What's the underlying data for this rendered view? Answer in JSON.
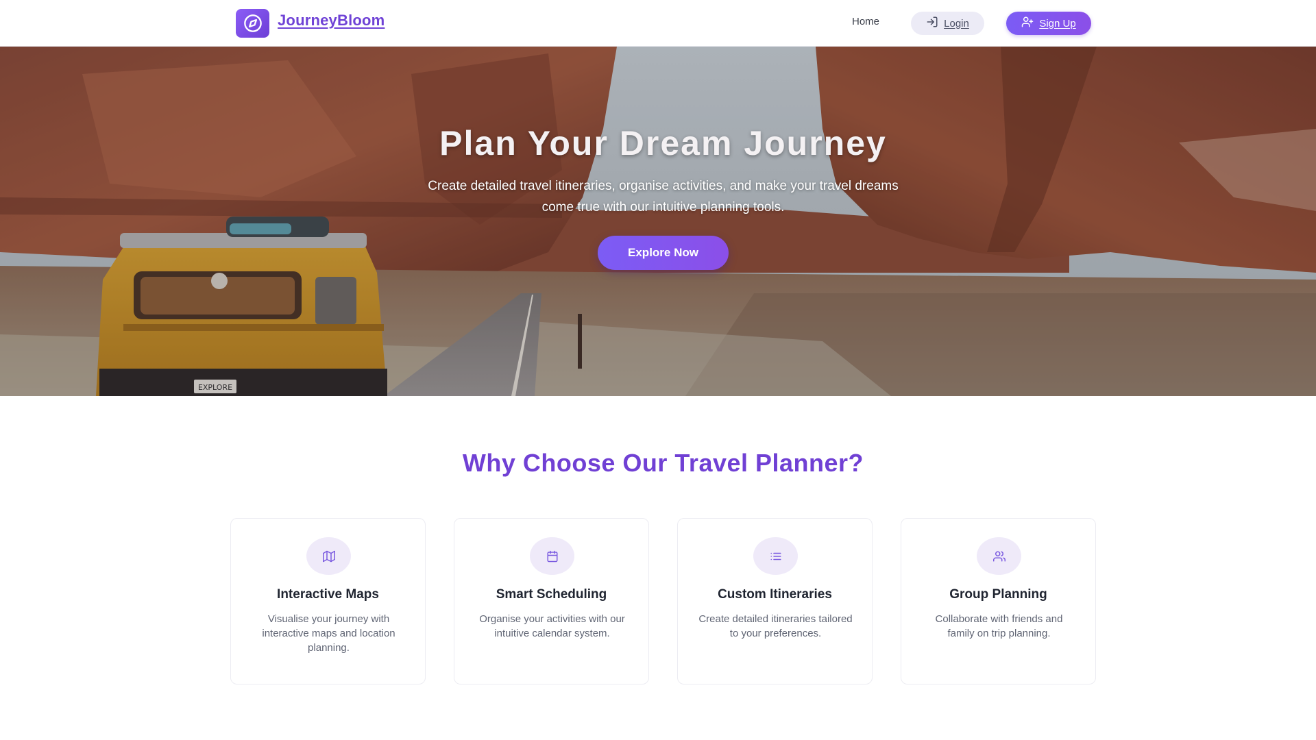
{
  "nav": {
    "brand": "JourneyBloom",
    "links": {
      "home": "Home",
      "login": "Login",
      "signup": "Sign Up"
    }
  },
  "hero": {
    "title": "Plan Your Dream Journey",
    "subtitle": "Create detailed travel itineraries, organise activities, and make your travel dreams come true with our intuitive planning tools.",
    "cta": "Explore Now",
    "plate_text": "EXPLORE"
  },
  "features": {
    "title": "Why Choose Our Travel Planner?",
    "cards": [
      {
        "icon": "map-icon",
        "title": "Interactive Maps",
        "text": "Visualise your journey with interactive maps and location planning."
      },
      {
        "icon": "calendar-icon",
        "title": "Smart Scheduling",
        "text": "Organise your activities with our intuitive calendar system."
      },
      {
        "icon": "list-icon",
        "title": "Custom Itineraries",
        "text": "Create detailed itineraries tailored to your preferences."
      },
      {
        "icon": "users-icon",
        "title": "Group Planning",
        "text": "Collaborate with friends and family on trip planning."
      }
    ]
  },
  "colors": {
    "accent": "#7040d4",
    "button_gradient_start": "#7c5cf5",
    "button_gradient_end": "#8b4fe8",
    "icon_circle": "#efeaf9"
  }
}
